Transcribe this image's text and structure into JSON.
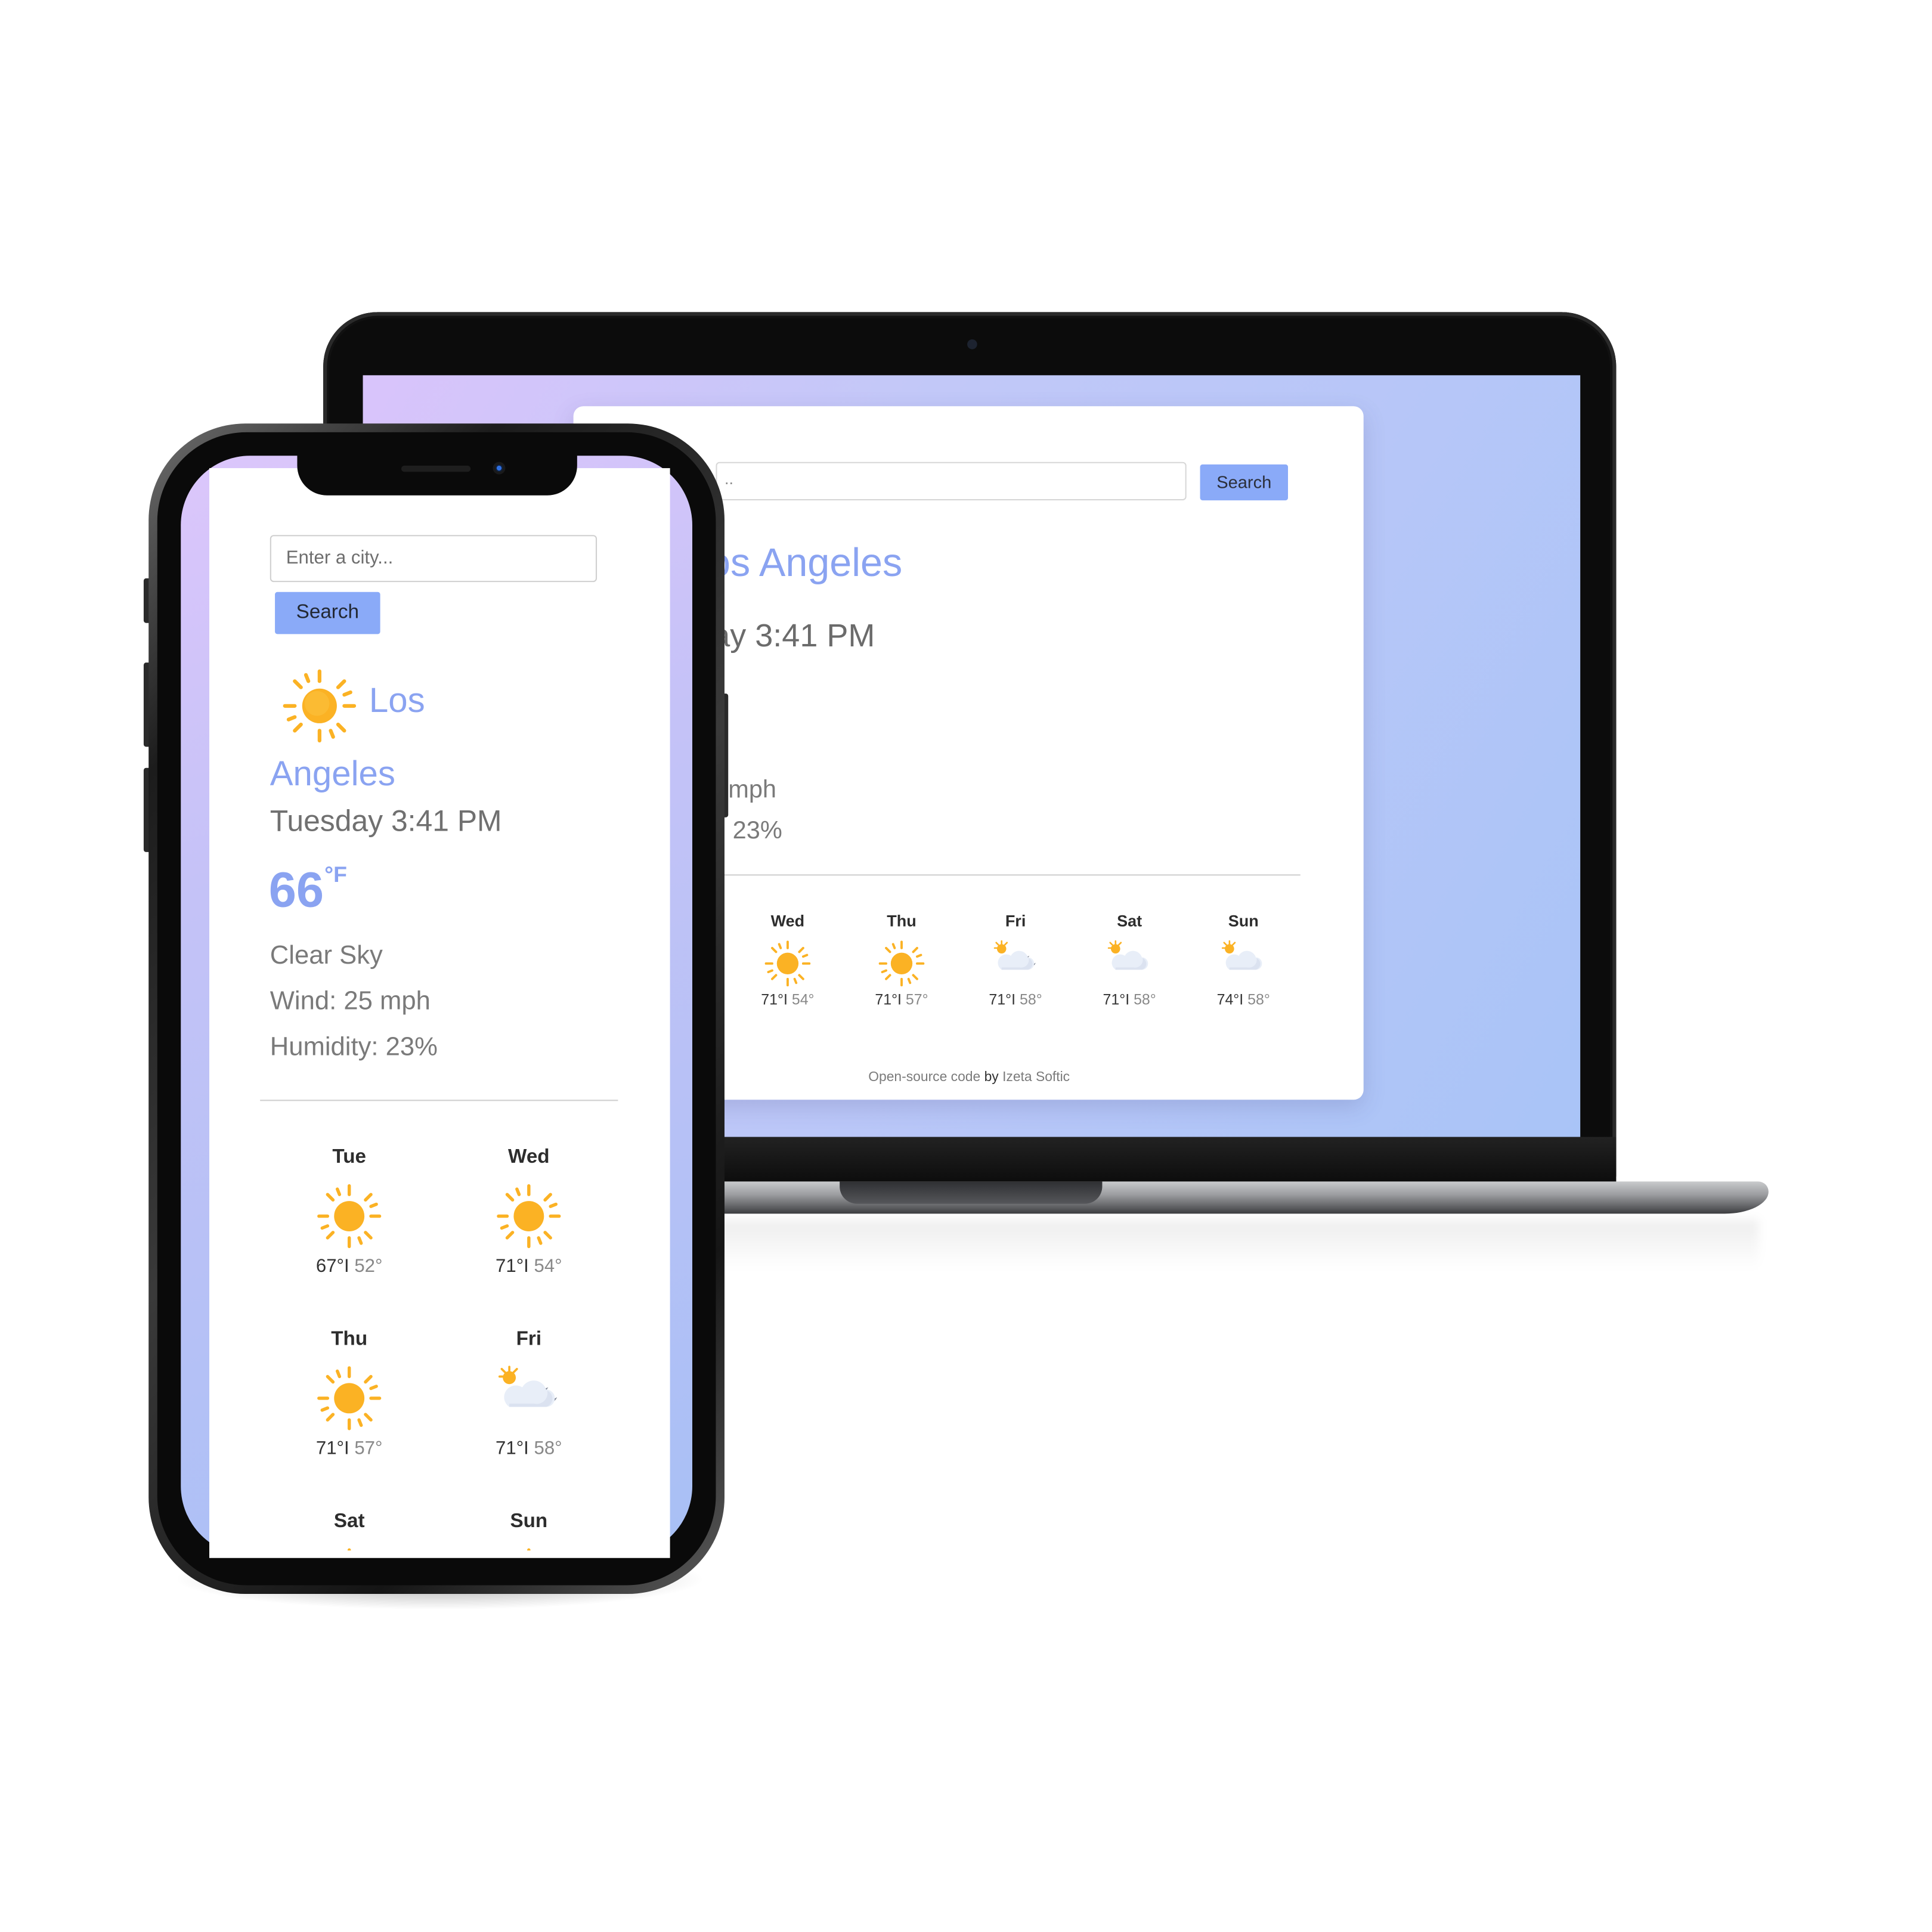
{
  "laptop": {
    "search": {
      "placeholder_visible": "..",
      "button_label": "Search"
    },
    "city_visible": "os Angeles",
    "time_visible": "ay 3:41 PM",
    "wind_visible": "mph",
    "humidity_visible": "23%",
    "forecast": [
      {
        "day": "Wed",
        "high": "71°",
        "low": "54°",
        "icon": "sun-icon"
      },
      {
        "day": "Thu",
        "high": "71°",
        "low": "57°",
        "icon": "sun-icon"
      },
      {
        "day": "Fri",
        "high": "71°",
        "low": "58°",
        "icon": "partly-cloudy-night-icon"
      },
      {
        "day": "Sat",
        "high": "71°",
        "low": "58°",
        "icon": "partly-cloudy-icon"
      },
      {
        "day": "Sun",
        "high": "74°",
        "low": "58°",
        "icon": "partly-cloudy-icon"
      }
    ],
    "footer": {
      "link1": "Open-source code",
      "by": "by",
      "author": "Izeta Softic"
    }
  },
  "phone": {
    "search": {
      "placeholder": "Enter a city...",
      "button_label": "Search"
    },
    "city_line1": "Los",
    "city_line2": "Angeles",
    "time": "Tuesday 3:41 PM",
    "temperature": "66",
    "unit": "°F",
    "description": "Clear Sky",
    "wind": "Wind: 25 mph",
    "humidity": "Humidity: 23%",
    "forecast": [
      {
        "day": "Tue",
        "high": "67°",
        "low": "52°",
        "icon": "sun-icon"
      },
      {
        "day": "Wed",
        "high": "71°",
        "low": "54°",
        "icon": "sun-icon"
      },
      {
        "day": "Thu",
        "high": "71°",
        "low": "57°",
        "icon": "sun-icon"
      },
      {
        "day": "Fri",
        "high": "71°",
        "low": "58°",
        "icon": "partly-cloudy-night-icon"
      },
      {
        "day": "Sat",
        "high": "",
        "low": "",
        "icon": "sun-icon"
      },
      {
        "day": "Sun",
        "high": "",
        "low": "",
        "icon": "sun-icon"
      }
    ]
  },
  "colors": {
    "accent": "#8aa3f1",
    "button": "#8aaaf8",
    "sun": "#fbb224"
  }
}
